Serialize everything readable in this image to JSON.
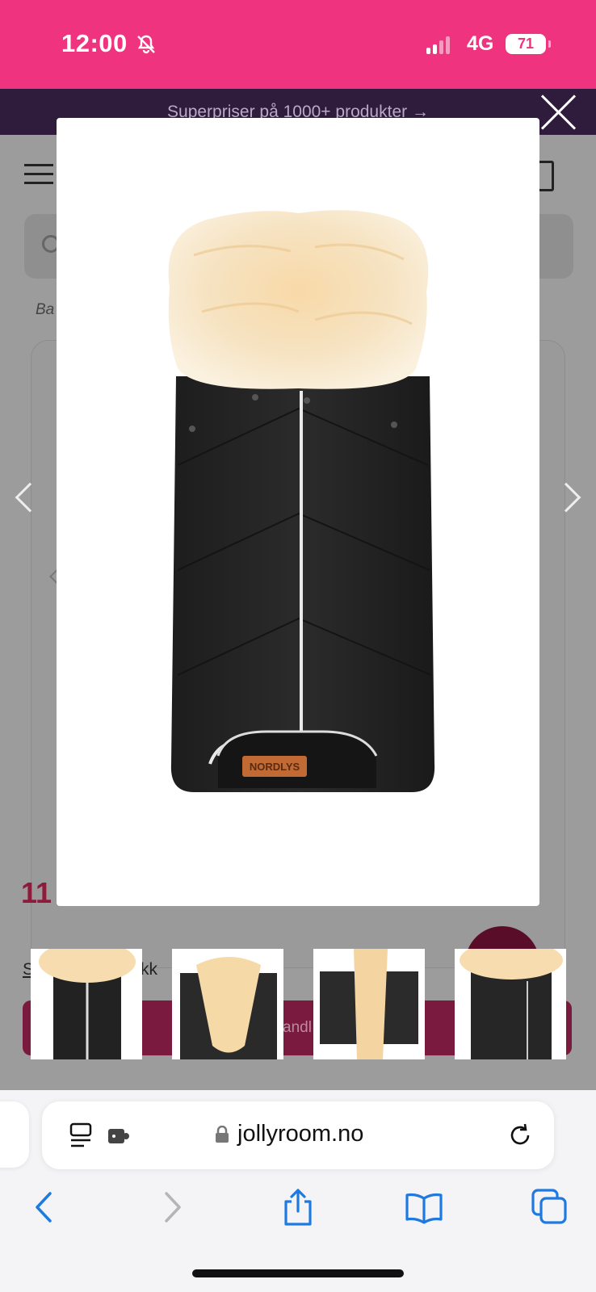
{
  "status_bar": {
    "time": "12:00",
    "network": "4G",
    "battery": "71",
    "bg_color": "#f0337f"
  },
  "promo_banner": {
    "text": "Superpriser på 1000+ produkter →"
  },
  "breadcrumb": {
    "text": "Ba"
  },
  "price": {
    "text": "11"
  },
  "link_text": {
    "left": "S",
    "right": "kk"
  },
  "buy_button": {
    "partial_label": "andl"
  },
  "modal": {
    "product_brand_label": "NORDLYS",
    "close_icon": "close-icon"
  },
  "thumbnails": [
    {
      "name": "thumb-1"
    },
    {
      "name": "thumb-2"
    },
    {
      "name": "thumb-3"
    },
    {
      "name": "thumb-4"
    }
  ],
  "safari": {
    "domain": "jollyroom.no",
    "icons": [
      "reader-icon",
      "extension-icon",
      "lock-icon",
      "reload-icon",
      "back-icon",
      "forward-icon",
      "share-icon",
      "bookmarks-icon",
      "tabs-icon"
    ],
    "accent": "#1f7ae0"
  }
}
